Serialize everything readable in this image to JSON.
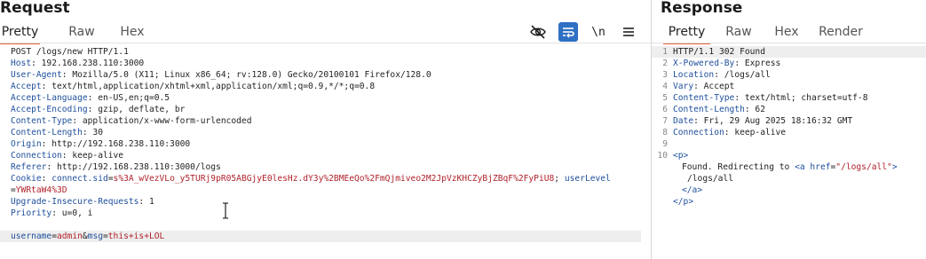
{
  "request": {
    "title": "Request",
    "tabs": [
      {
        "label": "Pretty",
        "active": true
      },
      {
        "label": "Raw",
        "active": false
      },
      {
        "label": "Hex",
        "active": false
      }
    ],
    "toolbar": {
      "icons": [
        "eye-off-icon",
        "wrap-icon",
        "newline-toggle",
        "menu-icon"
      ],
      "newline_label": "\\n"
    },
    "lines": {
      "l1": "POST /logs/new HTTP/1.1",
      "l2k": "Host",
      "l2v": ": 192.168.238.110:3000",
      "l3k": "User-Agent",
      "l3v": ": Mozilla/5.0 (X11; Linux x86_64; rv:128.0) Gecko/20100101 Firefox/128.0",
      "l4k": "Accept",
      "l4v": ": text/html,application/xhtml+xml,application/xml;q=0.9,*/*;q=0.8",
      "l5k": "Accept-Language",
      "l5v": ": en-US,en;q=0.5",
      "l6k": "Accept-Encoding",
      "l6v": ": gzip, deflate, br",
      "l7k": "Content-Type",
      "l7v": ": application/x-www-form-urlencoded",
      "l8k": "Content-Length",
      "l8v": ": 30",
      "l9k": "Origin",
      "l9v": ": http://192.168.238.110:3000",
      "l10k": "Connection",
      "l10v": ": keep-alive",
      "l11k": "Referer",
      "l11v": ": http://192.168.238.110:3000/logs",
      "l12k": "Cookie",
      "l12sep": ": ",
      "l12c1k": "connect.sid",
      "l12c1eq": "=",
      "l12c1v": "s%3A_wVezVLo_y5TURj9pR05ABGjyE0lesHz.dY3y%2BMEeQo%2FmQjmiveo2M2JpVzKHCZyBjZBqF%2FyPiU8",
      "l12semi": "; ",
      "l12c2k": "userLevel",
      "l12c2eq": "=",
      "l12c2v": "YWRtaW4%3D",
      "l13k": "Upgrade-Insecure-Requests",
      "l13v": ": 1",
      "l14k": "Priority",
      "l14v": ": u=0, i",
      "body_k1": "username",
      "body_eq1": "=",
      "body_v1": "admin",
      "body_amp": "&",
      "body_k2": "msg",
      "body_eq2": "=",
      "body_v2": "this+is+LOL"
    }
  },
  "response": {
    "title": "Response",
    "tabs": [
      {
        "label": "Pretty",
        "active": true
      },
      {
        "label": "Raw",
        "active": false
      },
      {
        "label": "Hex",
        "active": false
      },
      {
        "label": "Render",
        "active": false
      }
    ],
    "line_numbers": [
      "1",
      "2",
      "3",
      "4",
      "5",
      "6",
      "7",
      "8",
      "9",
      "10"
    ],
    "lines": {
      "r1": "HTTP/1.1 302 Found",
      "r2k": "X-Powered-By",
      "r2v": ": Express",
      "r3k": "Location",
      "r3v": ": /logs/all",
      "r4k": "Vary",
      "r4v": ": Accept",
      "r5k": "Content-Type",
      "r5v": ": text/html; charset=utf-8",
      "r6k": "Content-Length",
      "r6v": ": 62",
      "r7k": "Date",
      "r7v": ": Fri, 29 Aug 2025 18:16:32 GMT",
      "r8k": "Connection",
      "r8v": ": keep-alive",
      "r10_open_p": "<p>",
      "r11_text": "Found. Redirecting to ",
      "r11_a_open": "<a ",
      "r11_attr": "href",
      "r11_eq": "=",
      "r11_val": "\"/logs/all\"",
      "r11_close": ">",
      "r12_text": "/logs/all",
      "r13_a_close": "</a>",
      "r14_p_close": "</p>"
    }
  },
  "colors": {
    "accent_tab": "#e8643c",
    "header_key": "#1e4f9c",
    "value_red": "#b0222b",
    "active_tool": "#2f6fc4"
  }
}
